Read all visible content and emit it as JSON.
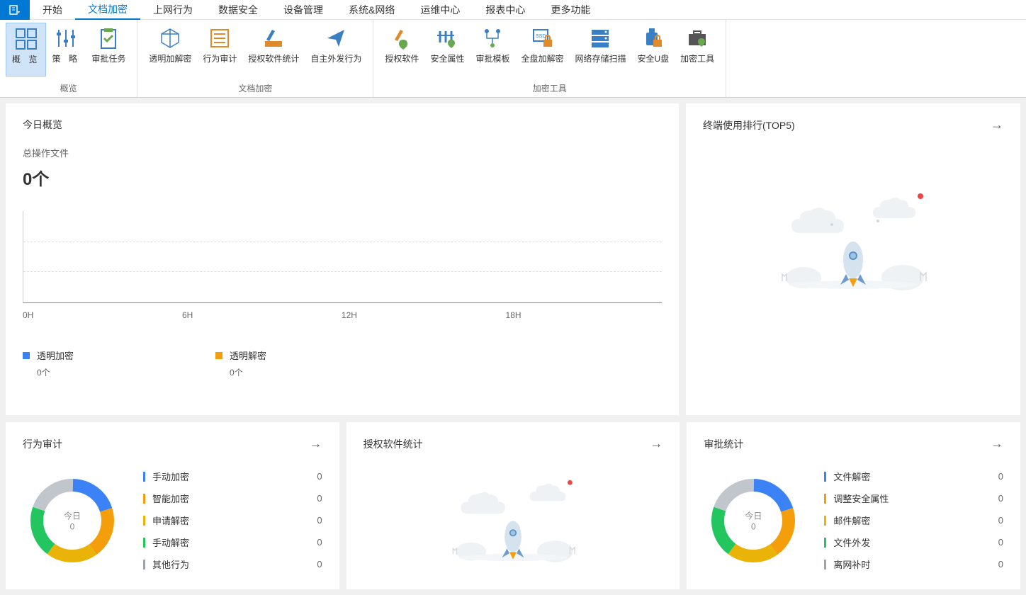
{
  "tabs": [
    "开始",
    "文档加密",
    "上网行为",
    "数据安全",
    "设备管理",
    "系统&网络",
    "运维中心",
    "报表中心",
    "更多功能"
  ],
  "activeTab": 1,
  "ribbon": {
    "groups": [
      {
        "label": "概览",
        "buttons": [
          {
            "label": "概  览",
            "icon": "grid",
            "active": true
          },
          {
            "label": "策  略",
            "icon": "sliders"
          },
          {
            "label": "审批任务",
            "icon": "clipboard-check",
            "tight": true
          }
        ]
      },
      {
        "label": "文档加密",
        "buttons": [
          {
            "label": "透明加解密",
            "icon": "cube",
            "tight": true
          },
          {
            "label": "行为审计",
            "icon": "list",
            "tight": true
          },
          {
            "label": "授权软件统计",
            "icon": "pencil-ruler",
            "tight": true
          },
          {
            "label": "自主外发行为",
            "icon": "paper-plane",
            "tight": true
          }
        ]
      },
      {
        "label": "加密工具",
        "buttons": [
          {
            "label": "授权软件",
            "icon": "pen-shield",
            "tight": true
          },
          {
            "label": "安全属性",
            "icon": "fence-shield",
            "tight": true
          },
          {
            "label": "审批模板",
            "icon": "flow",
            "tight": true
          },
          {
            "label": "全盘加解密",
            "icon": "ssd-lock",
            "tight": true
          },
          {
            "label": "网络存储扫描",
            "icon": "servers",
            "tight": true
          },
          {
            "label": "安全U盘",
            "icon": "usb-lock",
            "tight": true
          },
          {
            "label": "加密工具",
            "icon": "briefcase-shield",
            "tight": true
          }
        ]
      }
    ]
  },
  "todayOverview": {
    "title": "今日概览",
    "metricLabel": "总操作文件",
    "metricValue": "0个",
    "xAxis": [
      "0H",
      "6H",
      "12H",
      "18H"
    ],
    "legend": [
      {
        "name": "透明加密",
        "count": "0个",
        "color": "#3b82f6"
      },
      {
        "name": "透明解密",
        "count": "0个",
        "color": "#f59e0b"
      }
    ]
  },
  "terminalRanking": {
    "title": "终端使用排行(TOP5)"
  },
  "behaviorAudit": {
    "title": "行为审计",
    "centerLabel": "今日",
    "centerValue": "0",
    "items": [
      {
        "label": "手动加密",
        "value": 0,
        "color": "#3b82f6"
      },
      {
        "label": "智能加密",
        "value": 0,
        "color": "#f59e0b"
      },
      {
        "label": "申请解密",
        "value": 0,
        "color": "#eab308"
      },
      {
        "label": "手动解密",
        "value": 0,
        "color": "#22c55e"
      },
      {
        "label": "其他行为",
        "value": 0,
        "color": "#9ca3af"
      }
    ]
  },
  "authSoftware": {
    "title": "授权软件统计"
  },
  "approvalStats": {
    "title": "审批统计",
    "centerLabel": "今日",
    "centerValue": "0",
    "items": [
      {
        "label": "文件解密",
        "value": 0,
        "color": "#3b82f6"
      },
      {
        "label": "调整安全属性",
        "value": 0,
        "color": "#f59e0b"
      },
      {
        "label": "邮件解密",
        "value": 0,
        "color": "#eab308"
      },
      {
        "label": "文件外发",
        "value": 0,
        "color": "#22c55e"
      },
      {
        "label": "离网补时",
        "value": 0,
        "color": "#9ca3af"
      }
    ]
  },
  "chart_data": [
    {
      "type": "line",
      "title": "今日概览",
      "xlabel": "",
      "ylabel": "",
      "x": [
        "0H",
        "6H",
        "12H",
        "18H"
      ],
      "series": [
        {
          "name": "透明加密",
          "values": [
            0,
            0,
            0,
            0
          ]
        },
        {
          "name": "透明解密",
          "values": [
            0,
            0,
            0,
            0
          ]
        }
      ],
      "ylim": [
        0,
        1
      ]
    },
    {
      "type": "pie",
      "title": "行为审计 今日",
      "categories": [
        "手动加密",
        "智能加密",
        "申请解密",
        "手动解密",
        "其他行为"
      ],
      "values": [
        0,
        0,
        0,
        0,
        0
      ]
    },
    {
      "type": "pie",
      "title": "审批统计 今日",
      "categories": [
        "文件解密",
        "调整安全属性",
        "邮件解密",
        "文件外发",
        "离网补时"
      ],
      "values": [
        0,
        0,
        0,
        0,
        0
      ]
    }
  ]
}
